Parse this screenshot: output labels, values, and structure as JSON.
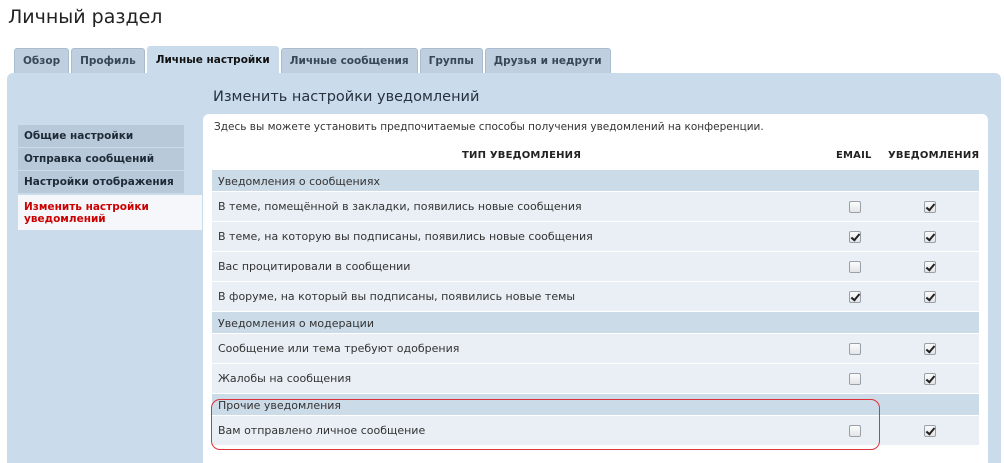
{
  "page": {
    "title": "Личный раздел"
  },
  "tabs": [
    {
      "label": "Обзор",
      "active": false
    },
    {
      "label": "Профиль",
      "active": false
    },
    {
      "label": "Личные настройки",
      "active": true
    },
    {
      "label": "Личные сообщения",
      "active": false
    },
    {
      "label": "Группы",
      "active": false
    },
    {
      "label": "Друзья и недруги",
      "active": false
    }
  ],
  "sidebar": {
    "items": [
      {
        "label": "Общие настройки"
      },
      {
        "label": "Отправка сообщений"
      },
      {
        "label": "Настройки отображения"
      },
      {
        "label": "Изменить настройки уведомлений"
      }
    ]
  },
  "main": {
    "title": "Изменить настройки уведомлений",
    "intro": "Здесь вы можете установить предпочитаемые способы получения уведомлений на конференции.",
    "columns": {
      "type": "ТИП УВЕДОМЛЕНИЯ",
      "email": "EMAIL",
      "notifications": "УВЕДОМЛЕНИЯ"
    },
    "groups": [
      {
        "title": "Уведомления о сообщениях",
        "items": [
          {
            "label": "В теме, помещённой в закладки, появились новые сообщения",
            "email": false,
            "notify": true
          },
          {
            "label": "В теме, на которую вы подписаны, появились новые сообщения",
            "email": true,
            "notify": true
          },
          {
            "label": "Вас процитировали в сообщении",
            "email": false,
            "notify": true
          },
          {
            "label": "В форуме, на который вы подписаны, появились новые темы",
            "email": true,
            "notify": true
          }
        ]
      },
      {
        "title": "Уведомления о модерации",
        "items": [
          {
            "label": "Сообщение или тема требуют одобрения",
            "email": false,
            "notify": true
          },
          {
            "label": "Жалобы на сообщения",
            "email": false,
            "notify": true
          }
        ]
      },
      {
        "title": "Прочие уведомления",
        "items": [
          {
            "label": "Вам отправлено личное сообщение",
            "email": false,
            "notify": true
          }
        ]
      }
    ]
  },
  "colors": {
    "panel": "#cadceb",
    "active_nav_text": "#cc0000",
    "highlight": "#e0323a"
  }
}
